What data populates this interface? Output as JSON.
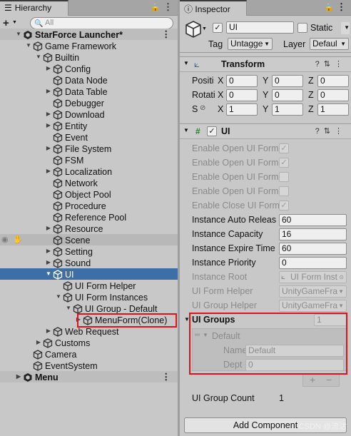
{
  "hierarchy": {
    "tab_label": "Hierarchy",
    "search_placeholder": "All",
    "items": [
      {
        "label": "StarForce Launcher*",
        "depth": 0,
        "kind": "scene",
        "expand": "open"
      },
      {
        "label": "Game Framework",
        "depth": 1,
        "kind": "go",
        "expand": "open"
      },
      {
        "label": "Builtin",
        "depth": 2,
        "kind": "go",
        "expand": "open"
      },
      {
        "label": "Config",
        "depth": 3,
        "kind": "go",
        "expand": "closed"
      },
      {
        "label": "Data Node",
        "depth": 3,
        "kind": "go",
        "expand": "none"
      },
      {
        "label": "Data Table",
        "depth": 3,
        "kind": "go",
        "expand": "closed"
      },
      {
        "label": "Debugger",
        "depth": 3,
        "kind": "go",
        "expand": "none"
      },
      {
        "label": "Download",
        "depth": 3,
        "kind": "go",
        "expand": "closed"
      },
      {
        "label": "Entity",
        "depth": 3,
        "kind": "go",
        "expand": "closed"
      },
      {
        "label": "Event",
        "depth": 3,
        "kind": "go",
        "expand": "none"
      },
      {
        "label": "File System",
        "depth": 3,
        "kind": "go",
        "expand": "closed"
      },
      {
        "label": "FSM",
        "depth": 3,
        "kind": "go",
        "expand": "none"
      },
      {
        "label": "Localization",
        "depth": 3,
        "kind": "go",
        "expand": "closed"
      },
      {
        "label": "Network",
        "depth": 3,
        "kind": "go",
        "expand": "none"
      },
      {
        "label": "Object Pool",
        "depth": 3,
        "kind": "go",
        "expand": "none"
      },
      {
        "label": "Procedure",
        "depth": 3,
        "kind": "go",
        "expand": "none"
      },
      {
        "label": "Reference Pool",
        "depth": 3,
        "kind": "go",
        "expand": "none"
      },
      {
        "label": "Resource",
        "depth": 3,
        "kind": "go",
        "expand": "closed"
      },
      {
        "label": "Scene",
        "depth": 3,
        "kind": "go",
        "expand": "none",
        "dim": true
      },
      {
        "label": "Setting",
        "depth": 3,
        "kind": "go",
        "expand": "closed"
      },
      {
        "label": "Sound",
        "depth": 3,
        "kind": "go",
        "expand": "closed"
      },
      {
        "label": "UI",
        "depth": 3,
        "kind": "go",
        "expand": "open",
        "selected": true
      },
      {
        "label": "UI Form Helper",
        "depth": 4,
        "kind": "go",
        "expand": "none"
      },
      {
        "label": "UI Form Instances",
        "depth": 4,
        "kind": "go",
        "expand": "open"
      },
      {
        "label": "UI Group - Default",
        "depth": 5,
        "kind": "go",
        "expand": "open"
      },
      {
        "label": "MenuForm(Clone)",
        "depth": 6,
        "kind": "go",
        "expand": "closed",
        "highlight": true
      },
      {
        "label": "Web Request",
        "depth": 3,
        "kind": "go",
        "expand": "closed"
      },
      {
        "label": "Customs",
        "depth": 2,
        "kind": "go",
        "expand": "closed"
      },
      {
        "label": "Camera",
        "depth": 1,
        "kind": "go",
        "expand": "none"
      },
      {
        "label": "EventSystem",
        "depth": 1,
        "kind": "go",
        "expand": "none"
      },
      {
        "label": "Menu",
        "depth": 0,
        "kind": "scene",
        "expand": "closed"
      }
    ]
  },
  "inspector": {
    "tab_label": "Inspector",
    "object_name": "UI",
    "static_label": "Static",
    "tag_label": "Tag",
    "tag_value": "Untagge",
    "layer_label": "Layer",
    "layer_value": "Defaul",
    "transform": {
      "title": "Transform",
      "rows": [
        {
          "label": "Positi",
          "x": "0",
          "y": "0",
          "z": "0"
        },
        {
          "label": "Rotati",
          "x": "0",
          "y": "0",
          "z": "0"
        },
        {
          "label": "S",
          "x": "1",
          "y": "1",
          "z": "1"
        }
      ],
      "axis_x": "X",
      "axis_y": "Y",
      "axis_z": "Z"
    },
    "ui_component": {
      "title": "UI",
      "toggles": [
        {
          "label": "Enable Open UI Form",
          "checked": true
        },
        {
          "label": "Enable Open UI Form",
          "checked": true
        },
        {
          "label": "Enable Open UI Form",
          "checked": false
        },
        {
          "label": "Enable Open UI Form",
          "checked": false
        },
        {
          "label": "Enable Close UI Form",
          "checked": true
        }
      ],
      "fields": [
        {
          "label": "Instance Auto Releas",
          "value": "60"
        },
        {
          "label": "Instance Capacity",
          "value": "16"
        },
        {
          "label": "Instance Expire Time",
          "value": "60"
        },
        {
          "label": "Instance Priority",
          "value": "0"
        }
      ],
      "instance_root_label": "Instance Root",
      "instance_root_value": "UI Form Inst",
      "form_helper_label": "UI Form Helper",
      "form_helper_value": "UnityGameFra",
      "group_helper_label": "UI Group Helper",
      "group_helper_value": "UnityGameFra",
      "groups_label": "UI Groups",
      "groups_count": "1",
      "group_item_label": "Default",
      "group_name_label": "Name",
      "group_name_value": "Default",
      "group_depth_label": "Dept",
      "group_depth_value": "0",
      "plus_label": "+",
      "minus_label": "−",
      "group_count_label": "UI Group Count",
      "group_count_value": "1"
    },
    "add_component_label": "Add Component",
    "watermark": "CSDN @流沽"
  }
}
